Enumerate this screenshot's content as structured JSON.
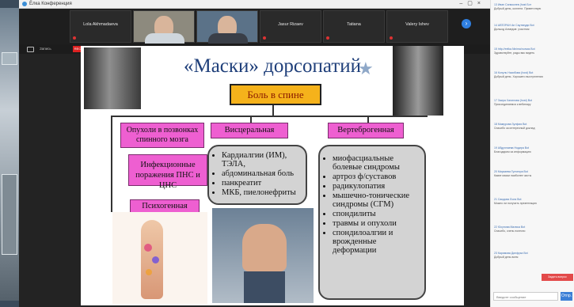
{
  "window": {
    "title": "Ёлка Конференция"
  },
  "participants": [
    {
      "name": "Lola Akhmadaeva"
    },
    {
      "name": "",
      "video": true
    },
    {
      "name": "",
      "video": true
    },
    {
      "name": "Jasur Rizaev"
    },
    {
      "name": "Tatiana"
    },
    {
      "name": "Valery Ishev"
    }
  ],
  "toolbar": {
    "cam_label": "Запись",
    "rec_label": "REC"
  },
  "slide": {
    "title": "«Маски» дорсопатий",
    "main": "Боль в спине",
    "categories": [
      "Опухоли в позвонках спинного мозга",
      "Висцеральная",
      "Вертеброгенная"
    ],
    "left_boxes": [
      "Инфекционные поражения ПНС и ЦНС",
      "Психогенная"
    ],
    "visceral_list": [
      "Кардиалгии (ИМ), ТЭЛА,",
      "абдоминальная боль",
      "панкреатит",
      "МКБ, пиелонефриты"
    ],
    "vertebro_list": [
      "миофасциальные болевые синдромы",
      "артроз ф/суставов",
      "радикулопатия",
      "мышечно-тонические синдромы (СГМ)",
      "спондилиты",
      "травмы и опухоли",
      "спондилоалгии и врожденные деформации"
    ]
  },
  "chat": {
    "messages": [
      {
        "meta": "13 Иван Сагмоклев (host Бот",
        "text": "Добрый день, коллеги. Приветствую"
      },
      {
        "meta": "14 АВТОРАН Ан Саутвеуди Bot",
        "text": "Дилшод Ахмедов: участник"
      },
      {
        "meta": "15 http://eelka.Ninima/nursas Bot",
        "text": "Здравствуйте, рады вас видеть"
      },
      {
        "meta": "16 Конуль Насибова (host) Bot",
        "text": "Добрый день. Хорошего выступления"
      },
      {
        "meta": "17 Заира Халилова (host) Bot",
        "text": "Присоединяемся к вебинару"
      },
      {
        "meta": "18 Мамурова Зулфия Bot",
        "text": "Спасибо за интересный доклад"
      },
      {
        "meta": "19 Абдуллаева Нодира Bot",
        "text": "Благодарим за информацию"
      },
      {
        "meta": "20 Мирзаева Гулчехра Bot",
        "text": "Какие маски наиболее часты"
      },
      {
        "meta": "21 Саидова Лола Bot",
        "text": "Можно ли получить презентацию"
      },
      {
        "meta": "22 Юсупова Малика Bot",
        "text": "Спасибо, очень полезно"
      },
      {
        "meta": "23 Каримова Дилфуза Bot",
        "text": "Добрый день всем"
      }
    ],
    "input_placeholder": "Введите сообщение",
    "send_label": "Отпр.",
    "red_button": "Задать вопрос"
  }
}
